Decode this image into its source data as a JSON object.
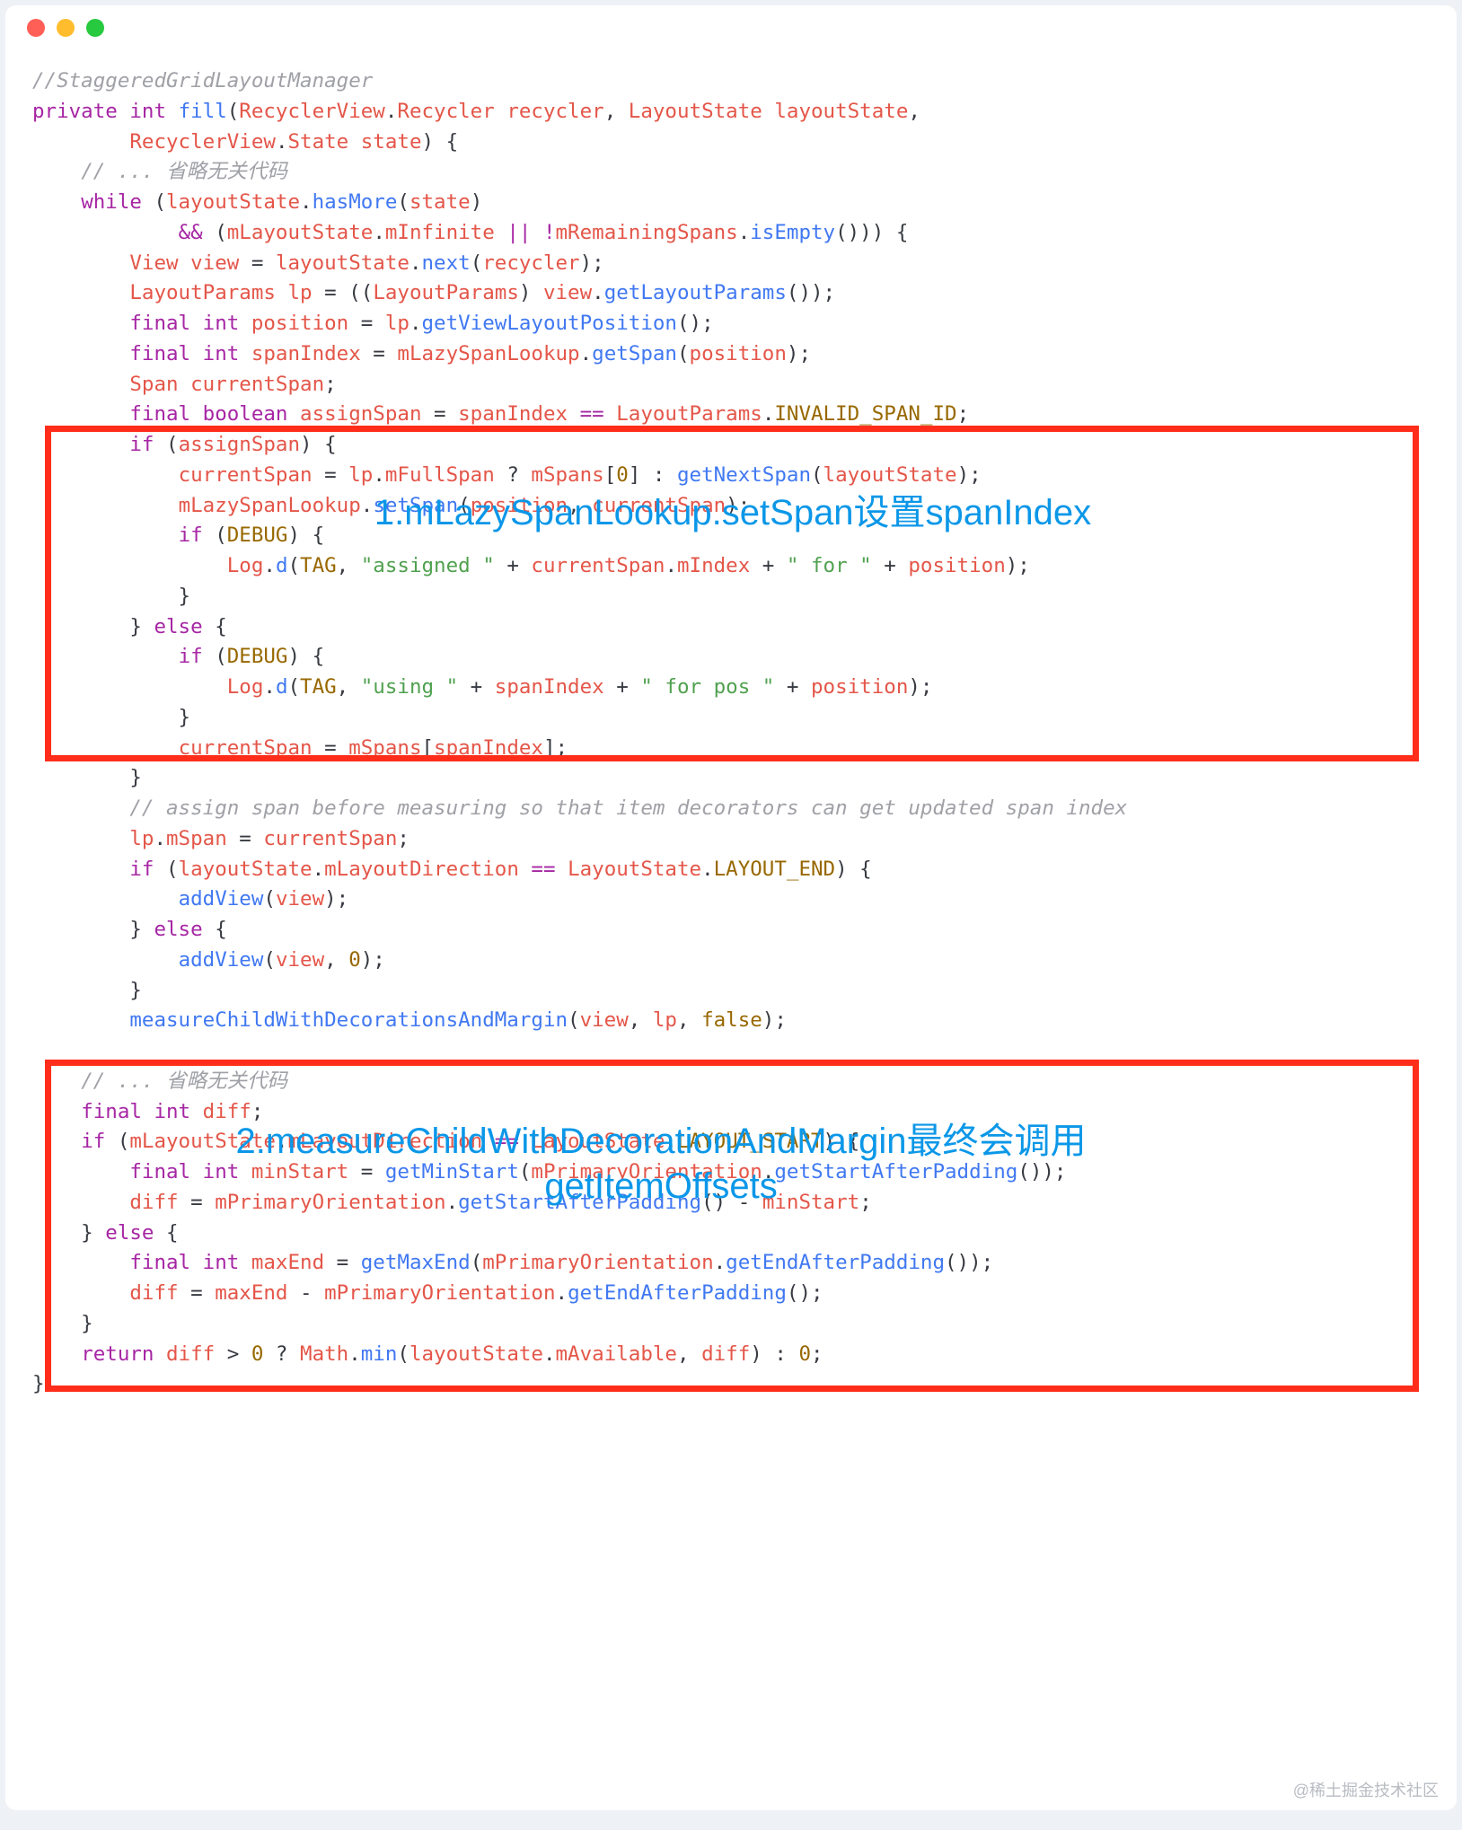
{
  "window": {
    "dots": [
      "red",
      "yellow",
      "green"
    ]
  },
  "annotations": {
    "a1": "1.mLazySpanLookup.setSpan设置spanIndex",
    "a2": "2.measureChildWithDecorationAndMargin最终会调用getItemOffsets"
  },
  "watermark": "@稀土掘金技术社区",
  "code": {
    "l1_comment": "//StaggeredGridLayoutManager",
    "l2": {
      "kw_private": "private",
      "kw_int": "int",
      "fn": "fill",
      "ty_rv": "RecyclerView",
      "p_dot": ".",
      "ty_rec": "Recycler",
      "arg1": "recycler",
      "ty_ls": "LayoutState",
      "arg2": "layoutState"
    },
    "l3": {
      "ty_rv": "RecyclerView",
      "ty_state": "State",
      "arg3": "state"
    },
    "l4_comment": "// ... 省略无关代码",
    "l5": {
      "kw_while": "while",
      "obj": "layoutState",
      "fn": "hasMore",
      "arg": "state"
    },
    "l6": {
      "op": "&&",
      "obj": "mLayoutState",
      "fld": "mInfinite",
      "op2": "||",
      "neg": "!",
      "obj2": "mRemainingSpans",
      "fn": "isEmpty"
    },
    "l7": {
      "ty": "View",
      "var": "view",
      "obj": "layoutState",
      "fn": "next",
      "arg": "recycler"
    },
    "l8": {
      "ty": "LayoutParams",
      "var": "lp",
      "cast": "LayoutParams",
      "obj": "view",
      "fn": "getLayoutParams"
    },
    "l9": {
      "kw_final": "final",
      "kw_int": "int",
      "var": "position",
      "obj": "lp",
      "fn": "getViewLayoutPosition"
    },
    "l10": {
      "kw_final": "final",
      "kw_int": "int",
      "var": "spanIndex",
      "obj": "mLazySpanLookup",
      "fn": "getSpan",
      "arg": "position"
    },
    "l11": {
      "ty": "Span",
      "var": "currentSpan"
    },
    "l12": {
      "kw_final": "final",
      "kw_boolean": "boolean",
      "var": "assignSpan",
      "rhs": "spanIndex",
      "op": "==",
      "obj": "LayoutParams",
      "cst": "INVALID_SPAN_ID"
    },
    "l13": {
      "kw_if": "if",
      "cond": "assignSpan"
    },
    "l14": {
      "lhs": "currentSpan",
      "obj": "lp",
      "fld": "mFullSpan",
      "q": "?",
      "arr": "mSpans",
      "idx": "0",
      "colon": ":",
      "fn": "getNextSpan",
      "arg": "layoutState"
    },
    "l15": {
      "obj": "mLazySpanLookup",
      "fn": "setSpan",
      "a1": "position",
      "a2": "currentSpan"
    },
    "l16": {
      "kw_if": "if",
      "cond": "DEBUG"
    },
    "l17": {
      "obj": "Log",
      "fn": "d",
      "a1": "TAG",
      "s1": "\"assigned \"",
      "obj2": "currentSpan",
      "fld": "mIndex",
      "s2": "\" for \"",
      "a3": "position"
    },
    "l19": {
      "kw_else": "else"
    },
    "l20": {
      "kw_if": "if",
      "cond": "DEBUG"
    },
    "l21": {
      "obj": "Log",
      "fn": "d",
      "a1": "TAG",
      "s1": "\"using \"",
      "v1": "spanIndex",
      "s2": "\" for pos \"",
      "v2": "position"
    },
    "l23": {
      "lhs": "currentSpan",
      "arr": "mSpans",
      "idx": "spanIndex"
    },
    "l25_comment": "// assign span before measuring so that item decorators can get updated span index",
    "l26": {
      "obj": "lp",
      "fld": "mSpan",
      "rhs": "currentSpan"
    },
    "l27": {
      "kw_if": "if",
      "obj": "layoutState",
      "fld": "mLayoutDirection",
      "op": "==",
      "ty": "LayoutState",
      "cst": "LAYOUT_END"
    },
    "l28": {
      "fn": "addView",
      "arg": "view"
    },
    "l29": {
      "kw_else": "else"
    },
    "l30": {
      "fn": "addView",
      "a1": "view",
      "a2": "0"
    },
    "l32": {
      "fn": "measureChildWithDecorationsAndMargin",
      "a1": "view",
      "a2": "lp",
      "a3": "false"
    },
    "l34_comment": "// ... 省略无关代码",
    "l35": {
      "kw_final": "final",
      "kw_int": "int",
      "var": "diff"
    },
    "l36": {
      "kw_if": "if",
      "obj": "mLayoutState",
      "fld": "mLayoutDirection",
      "op": "==",
      "ty": "LayoutState",
      "cst": "LAYOUT_START"
    },
    "l37": {
      "kw_final": "final",
      "kw_int": "int",
      "var": "minStart",
      "fn": "getMinStart",
      "obj": "mPrimaryOrientation",
      "fn2": "getStartAfterPadding"
    },
    "l38": {
      "lhs": "diff",
      "obj": "mPrimaryOrientation",
      "fn": "getStartAfterPadding",
      "op": "-",
      "rhs": "minStart"
    },
    "l39": {
      "kw_else": "else"
    },
    "l40": {
      "kw_final": "final",
      "kw_int": "int",
      "var": "maxEnd",
      "fn": "getMaxEnd",
      "obj": "mPrimaryOrientation",
      "fn2": "getEndAfterPadding"
    },
    "l41": {
      "lhs": "diff",
      "rhs1": "maxEnd",
      "op": "-",
      "obj": "mPrimaryOrientation",
      "fn": "getEndAfterPadding"
    },
    "l43": {
      "kw_return": "return",
      "v": "diff",
      "op": ">",
      "z": "0",
      "q": "?",
      "obj": "Math",
      "fn": "min",
      "a1": "layoutState",
      "fld": "mAvailable",
      "a2": "diff",
      "colon": ":",
      "z2": "0"
    }
  }
}
